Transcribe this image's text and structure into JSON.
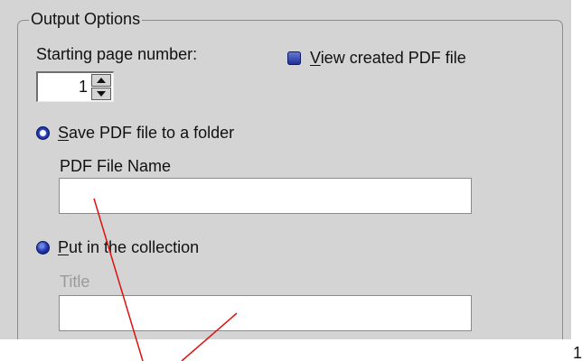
{
  "group": {
    "title": "Output Options"
  },
  "starting_page": {
    "label": "Starting page number:",
    "value": "1"
  },
  "view_pdf": {
    "label_first": "V",
    "label_rest": "iew created PDF file",
    "checked": true
  },
  "save_option": {
    "label_first": "S",
    "label_rest": "ave PDF file to a folder",
    "selected": true,
    "field_label": "PDF File Name",
    "field_value": ""
  },
  "collection_option": {
    "label_first": "P",
    "label_rest": "ut in the collection",
    "selected": false,
    "field_label": "Title",
    "field_value": ""
  },
  "colors": {
    "panel": "#d4d4d4",
    "accent": "#1b2c92",
    "annotation": "#e01010"
  },
  "edge_glyph": "1"
}
